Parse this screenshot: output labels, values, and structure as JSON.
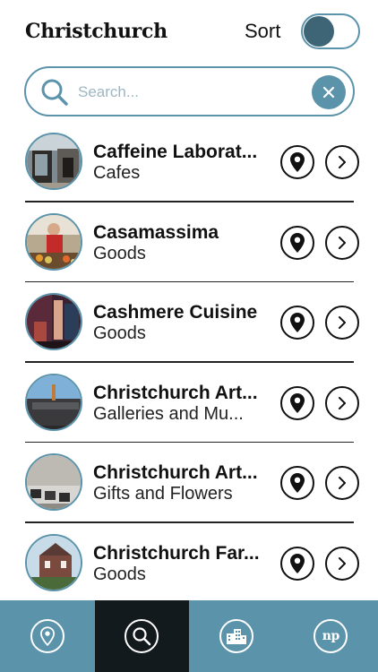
{
  "header": {
    "title": "Christchurch",
    "sort_label": "Sort",
    "sort_toggle": "on"
  },
  "search": {
    "placeholder": "Search...",
    "value": ""
  },
  "colors": {
    "accent": "#5b93ab",
    "accent_dark": "#3d6576",
    "active_tab": "#131a1e"
  },
  "listings": [
    {
      "name": "Caffeine Laborat...",
      "category": "Cafes"
    },
    {
      "name": "Casamassima",
      "category": "Goods"
    },
    {
      "name": "Cashmere Cuisine",
      "category": "Goods"
    },
    {
      "name": "Christchurch Art...",
      "category": "Galleries and Mu..."
    },
    {
      "name": "Christchurch Art...",
      "category": "Gifts and Flowers"
    },
    {
      "name": "Christchurch Far...",
      "category": "Goods"
    }
  ],
  "tabs": [
    {
      "icon": "map-pin-icon",
      "active": false
    },
    {
      "icon": "search-icon",
      "active": true
    },
    {
      "icon": "buildings-icon",
      "active": false
    },
    {
      "icon": "np-logo-icon",
      "label": "np",
      "active": false
    }
  ]
}
